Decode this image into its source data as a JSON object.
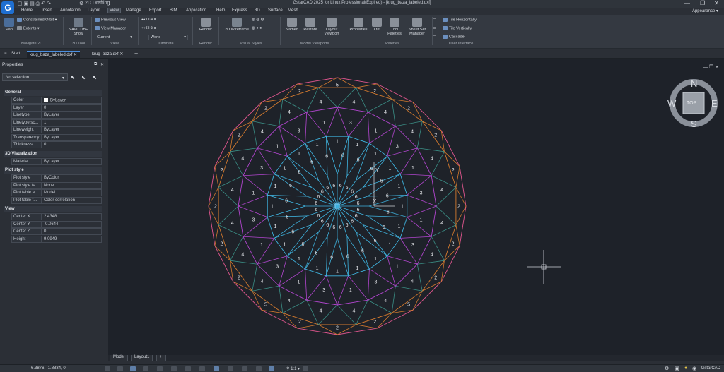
{
  "app": {
    "title": "GstarCAD 2025 for Linux Professional(Expired) - [krug_baza_labeled.dxf]",
    "workspace": "2D Drafting",
    "logo_letter": "G",
    "appearance_label": "Appearance"
  },
  "menu": [
    "Home",
    "Insert",
    "Annotation",
    "Layout",
    "View",
    "Manage",
    "Export",
    "BIM",
    "Application",
    "Help",
    "Express",
    "3D",
    "Surface",
    "Mesh"
  ],
  "menu_active": "View",
  "ribbon": {
    "navigate2d": {
      "label": "Navigate 2D",
      "pan": "Pan",
      "orbit": "Constrained Orbit",
      "extents": "Extents"
    },
    "tool3d": {
      "label": "3D Tool",
      "navicube": "NAVICUBE Show"
    },
    "view": {
      "label": "View",
      "previous": "Previous View",
      "manager": "View Manager",
      "current": "Current"
    },
    "ordinate": {
      "label": "Ordinate",
      "world": "World"
    },
    "render": {
      "label": "Render",
      "btn": "Render"
    },
    "visual": {
      "label": "Visual Styles",
      "btn": "2D Wireframe"
    },
    "viewports": {
      "label": "Model Viewports",
      "named": "Named",
      "restore": "Restore",
      "layout": "Layout Viewport"
    },
    "palettes": {
      "label": "Palettes",
      "properties": "Properties",
      "xref": "Xref",
      "tool": "Tool Palettes",
      "sheetset": "Sheet Set Manager"
    },
    "ui": {
      "label": "User Interface",
      "tileh": "Tile Horizontally",
      "tilev": "Tile Vertically",
      "cascade": "Cascade"
    }
  },
  "tabs": {
    "start": "Start",
    "files": [
      "krug_baza_labeled.dxf",
      "krug_baza.dxf"
    ]
  },
  "properties": {
    "title": "Properties",
    "selection": "No selection",
    "sections": [
      {
        "name": "General",
        "rows": [
          [
            "Color",
            "ByLayer"
          ],
          [
            "Layer",
            "0"
          ],
          [
            "Linetype",
            "ByLayer"
          ],
          [
            "Linetype sc...",
            "1"
          ],
          [
            "Lineweight",
            "ByLayer"
          ],
          [
            "Transparency",
            "ByLayer"
          ],
          [
            "Thickness",
            "0"
          ]
        ]
      },
      {
        "name": "3D Visualization",
        "rows": [
          [
            "Material",
            "ByLayer"
          ]
        ]
      },
      {
        "name": "Plot style",
        "rows": [
          [
            "Plot style",
            "ByColor"
          ],
          [
            "Plot style ta...",
            "None"
          ],
          [
            "Plot table a...",
            "Model"
          ],
          [
            "Plot table t...",
            "Color correlation"
          ]
        ]
      },
      {
        "name": "View",
        "rows": [
          [
            "Center X",
            "2.4348"
          ],
          [
            "Center Y",
            "-0.0644"
          ],
          [
            "Center Z",
            "0"
          ],
          [
            "Height",
            "9.0949"
          ]
        ]
      }
    ]
  },
  "navicube": {
    "n": "N",
    "s": "S",
    "e": "E",
    "w": "W",
    "top": "TOP"
  },
  "layout_tabs": [
    "Model",
    "Layout1",
    "+"
  ],
  "status": {
    "coords": "6.3876, -1.8834, 0",
    "scale": "1:1",
    "brand": "GstarCAD"
  },
  "colors": {
    "outer": "#e0568e",
    "orange": "#d47a2e",
    "teal": "#3b8f86",
    "purple": "#b246cf",
    "cyan": "#3fb4e0",
    "bg": "#1e2229"
  }
}
